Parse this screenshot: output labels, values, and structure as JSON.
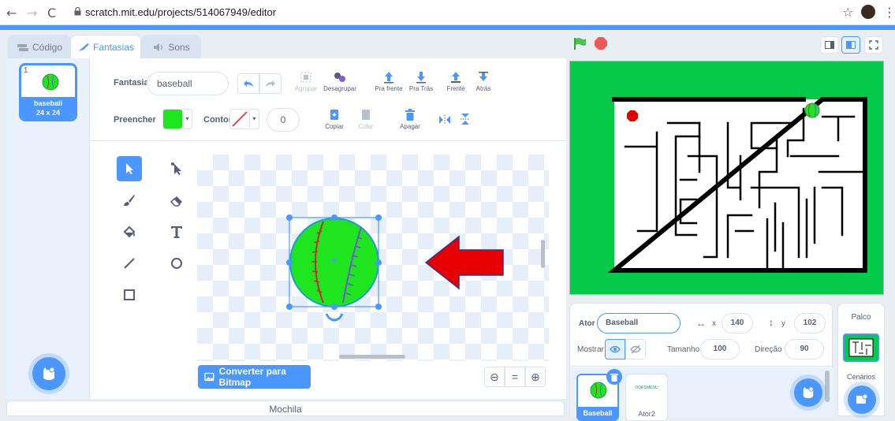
{
  "browser": {
    "url": "scratch.mit.edu/projects/514067949/editor"
  },
  "tabs": [
    {
      "label": "Código"
    },
    {
      "label": "Fantasias"
    },
    {
      "label": "Sons"
    }
  ],
  "costume_list": {
    "items": [
      {
        "number": "1",
        "name": "baseball",
        "size": "24 x 24"
      }
    ]
  },
  "toolbar": {
    "costume_label": "Fantasia",
    "costume_name": "baseball",
    "group_label": "Agrupar",
    "ungroup_label": "Desagrupar",
    "forward_label": "Pra frente",
    "backward_label": "Pra Trás",
    "front_label": "Frente",
    "back_label": "Atrás",
    "fill_label": "Preencher",
    "outline_label": "Contornar",
    "outline_width": "0",
    "copy_label": "Copiar",
    "paste_label": "Colar",
    "delete_label": "Apagar",
    "fill_color": "#1ee51e"
  },
  "canvas": {
    "convert_button": "Converter para Bitmap"
  },
  "backpack": {
    "label": "Mochila"
  },
  "sprite_info": {
    "sprite_label": "Ator",
    "sprite_name": "Baseball",
    "x_label": "x",
    "x_value": "140",
    "y_label": "y",
    "y_value": "102",
    "show_label": "Mostrar",
    "size_label": "Tamanho",
    "size_value": "100",
    "direction_label": "Direção",
    "direction_value": "90"
  },
  "sprites": [
    {
      "name": "Baseball"
    },
    {
      "name": "Ator2"
    }
  ],
  "sprite2_thumb_text": "OOESMENU",
  "stage_panel": {
    "title": "Palco",
    "backdrops_label": "Cenários"
  },
  "colors": {
    "accent": "#4c97ff",
    "stage_green": "#05c949",
    "ball_green": "#1ee51e",
    "arrow_red": "#e60000"
  }
}
